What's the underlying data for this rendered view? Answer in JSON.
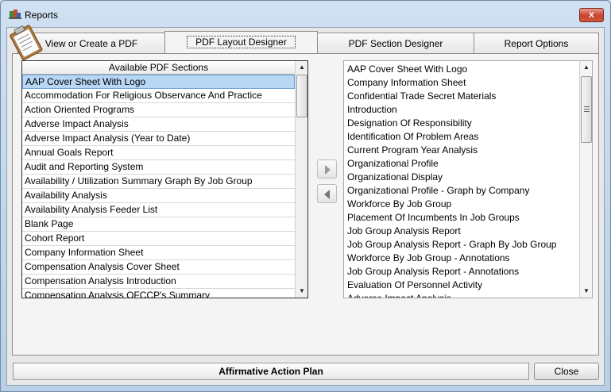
{
  "window": {
    "title": "Reports",
    "app_icon": "reports-app-icon",
    "close_glyph": "x"
  },
  "tabs": [
    {
      "label": "View or Create a PDF",
      "active": false
    },
    {
      "label": "PDF Layout Designer",
      "active": true
    },
    {
      "label": "PDF Section Designer",
      "active": false
    },
    {
      "label": "Report Options",
      "active": false
    }
  ],
  "available_sections": {
    "header": "Available PDF Sections",
    "selected_index": 0,
    "items": [
      "AAP Cover Sheet With Logo",
      "Accommodation For Religious Observance And Practice",
      "Action Oriented Programs",
      "Adverse Impact Analysis",
      "Adverse Impact Analysis (Year to Date)",
      "Annual Goals Report",
      "Audit and Reporting System",
      "Availability / Utilization Summary Graph By Job Group",
      "Availability Analysis",
      "Availability Analysis Feeder List",
      "Blank Page",
      "Cohort Report",
      "Company Information Sheet",
      "Compensation Analysis Cover Sheet",
      "Compensation Analysis Introduction",
      "Compensation Analysis OFCCP's Summary"
    ]
  },
  "layout_sections": {
    "items": [
      "AAP Cover Sheet With Logo",
      "Company Information Sheet",
      "Confidential Trade Secret Materials",
      "Introduction",
      "Designation Of Responsibility",
      "Identification Of Problem Areas",
      "Current Program Year Analysis",
      "Organizational Profile",
      "Organizational Display",
      "Organizational Profile  - Graph by Company",
      "Workforce By Job Group",
      "Placement Of Incumbents In Job Groups",
      "Job Group Analysis Report",
      "Job Group Analysis Report  - Graph By Job Group",
      "Workforce By Job Group - Annotations",
      "Job Group Analysis Report - Annotations",
      "Evaluation Of Personnel Activity",
      "Adverse Impact Analysis"
    ]
  },
  "buttons": {
    "add": "add-to-layout-arrow",
    "remove": "remove-from-layout-arrow",
    "close": "Close"
  },
  "status": {
    "plan_name": "Affirmative Action Plan"
  },
  "colors": {
    "selection": "#b7d7f4",
    "close_button": "#c8422c"
  }
}
